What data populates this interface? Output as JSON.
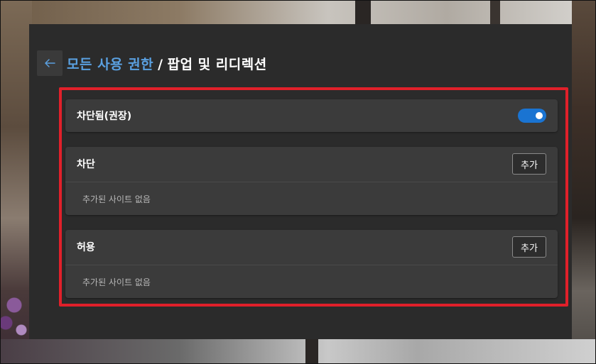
{
  "header": {
    "breadcrumb_parent": "모든 사용 권한",
    "separator": "/",
    "current": "팝업 및 리디렉션"
  },
  "blocked_setting": {
    "label": "차단됨(권장)",
    "enabled": true
  },
  "block_section": {
    "label": "차단",
    "add_label": "추가",
    "empty_text": "추가된 사이트 없음"
  },
  "allow_section": {
    "label": "허용",
    "add_label": "추가",
    "empty_text": "추가된 사이트 없음"
  },
  "colors": {
    "accent": "#5aa0e0",
    "toggle_on": "#1a74d2",
    "highlight": "#e0202a",
    "panel_bg": "#2b2b2b",
    "card_bg": "#3b3b3b"
  }
}
